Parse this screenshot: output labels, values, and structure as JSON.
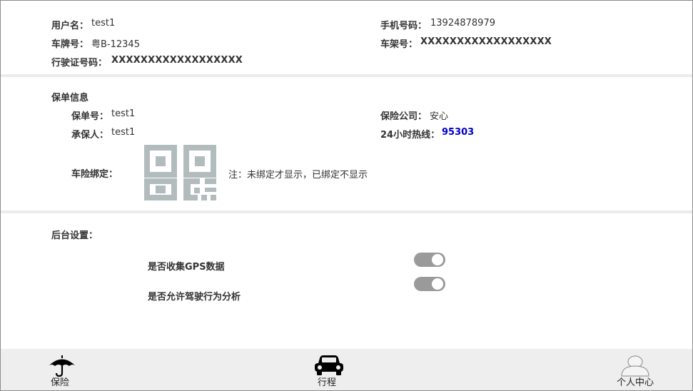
{
  "vehicle": {
    "username_label": "用户名：",
    "username": "test1",
    "phone_label": "手机号码：",
    "phone": "13924878979",
    "plate_label": "车牌号：",
    "plate": "粤B-12345",
    "frame_label": "车架号：",
    "frame": "XXXXXXXXXXXXXXXXXX",
    "license_label": "行驶证号码：",
    "license": "XXXXXXXXXXXXXXXXXX"
  },
  "policy": {
    "section_title": "保单信息",
    "number_label": "保单号：",
    "number": "test1",
    "company_label": "保险公司：",
    "company": "安心",
    "insured_label": "承保人：",
    "insured": "test1",
    "hotline_label": "24小时热线：",
    "hotline": "95303",
    "bind_label": "车险绑定：",
    "bind_note": "注：未绑定才显示，已绑定不显示"
  },
  "settings": {
    "section_title": "后台设置：",
    "gps_label": "是否收集GPS数据",
    "gps_enabled": true,
    "driving_label": "是否允许驾驶行为分析",
    "driving_enabled": true
  },
  "tabbar": {
    "insurance": "保险",
    "trip": "行程",
    "profile": "个人中心"
  },
  "colors": {
    "qr": "#b3bcbd",
    "toggle": "#9a9a9a",
    "hotline": "#0000cc",
    "tabbar_bg": "#eeeeee"
  },
  "icons": {
    "insurance": "umbrella-icon",
    "trip": "car-icon",
    "profile": "user-icon"
  }
}
